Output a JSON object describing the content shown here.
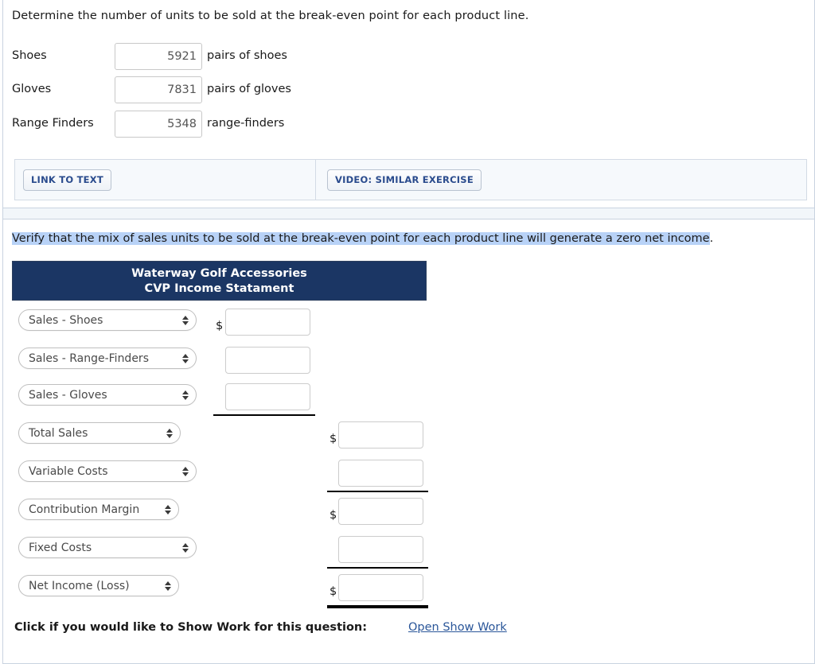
{
  "section_top": {
    "instruction": "Determine the number of units to be sold at the break-even point for each product line.",
    "unit_rows": [
      {
        "label": "Shoes",
        "value": "5921",
        "suffix": "pairs of shoes"
      },
      {
        "label": "Gloves",
        "value": "7831",
        "suffix": "pairs of gloves"
      },
      {
        "label": "Range Finders",
        "value": "5348",
        "suffix": "range-finders"
      }
    ],
    "link_to_text_button": "LINK TO TEXT",
    "video_button": "VIDEO: SIMILAR EXERCISE"
  },
  "section_bottom": {
    "verify_text_highlighted": "Verify that the mix of sales units to be sold at the break-even point for each product line will generate a zero net income",
    "verify_text_tail": ".",
    "statement_header": {
      "company": "Waterway Golf Accessories",
      "title": "CVP Income Statament",
      "background_color": "#1b3664",
      "text_color": "#ffffff"
    },
    "statement_rows": [
      {
        "select_value": "Sales - Shoes",
        "dollar": "$",
        "amount": ""
      },
      {
        "select_value": "Sales - Range-Finders",
        "dollar": "",
        "amount": ""
      },
      {
        "select_value": "Sales - Gloves",
        "dollar": "",
        "amount": ""
      },
      {
        "select_value": "Total Sales",
        "dollar": "$",
        "amount": ""
      },
      {
        "select_value": "Variable Costs",
        "dollar": "",
        "amount": ""
      },
      {
        "select_value": "Contribution Margin",
        "dollar": "$",
        "amount": ""
      },
      {
        "select_value": "Fixed Costs",
        "dollar": "",
        "amount": ""
      },
      {
        "select_value": "Net Income (Loss)",
        "dollar": "$",
        "amount": ""
      }
    ],
    "show_work_label": "Click if you would like to Show Work for this question:",
    "show_work_link": "Open Show Work",
    "show_work_link_color": "#2a5699"
  }
}
